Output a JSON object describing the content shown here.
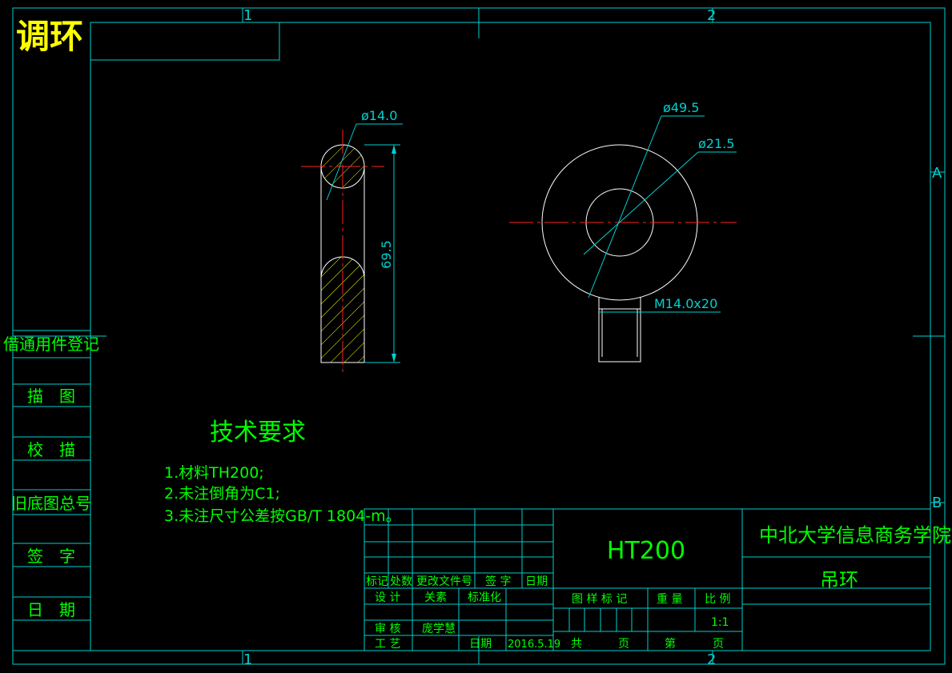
{
  "title_corner": "调环",
  "zone_numbers": {
    "col1": "1",
    "col2": "2",
    "row_a": "A",
    "row_b": "B"
  },
  "side_panel": {
    "items": [
      "借通用件登记",
      "描　图",
      "校　描",
      "旧底图总号",
      "签　字",
      "日　期"
    ]
  },
  "views": {
    "section": {
      "diameter_label": "ø14.0",
      "length_label": "69.5"
    },
    "top": {
      "outer_label": "ø49.5",
      "inner_label": "ø21.5",
      "thread_label": "M14.0x20"
    }
  },
  "tech_requirements": {
    "heading": "技术要求",
    "lines": [
      "1.材料TH200;",
      "2.未注倒角为C1;",
      "3.未注尺寸公差按GB/T 1804-m。"
    ]
  },
  "title_block": {
    "material": "HT200",
    "school": "中北大学信息商务学院",
    "part_name": "吊环",
    "revision_headers": [
      "标记",
      "处数",
      "更改文件号",
      "签 字",
      "日期"
    ],
    "design_label": "设 计",
    "designer": "关素",
    "standard_label": "标准化",
    "review_label": "审 核",
    "reviewer": "庞学慧",
    "process_label": "工 艺",
    "date_label": "日期",
    "date_value": "2016.5.19",
    "drawing_mark_label": "图 样 标 记",
    "weight_label": "重 量",
    "scale_label": "比 例",
    "scale_value": "1:1",
    "total_label": "共",
    "page_label": "页",
    "sheet_label": "第",
    "sheet_page_label": "页"
  },
  "colors": {
    "background": "#000000",
    "frame": "#00d0d0",
    "outline": "#ffffff",
    "center_line": "#ff2020",
    "hatch": "#ffff00",
    "text_green": "#00ff00",
    "title_yellow": "#ffff00"
  }
}
